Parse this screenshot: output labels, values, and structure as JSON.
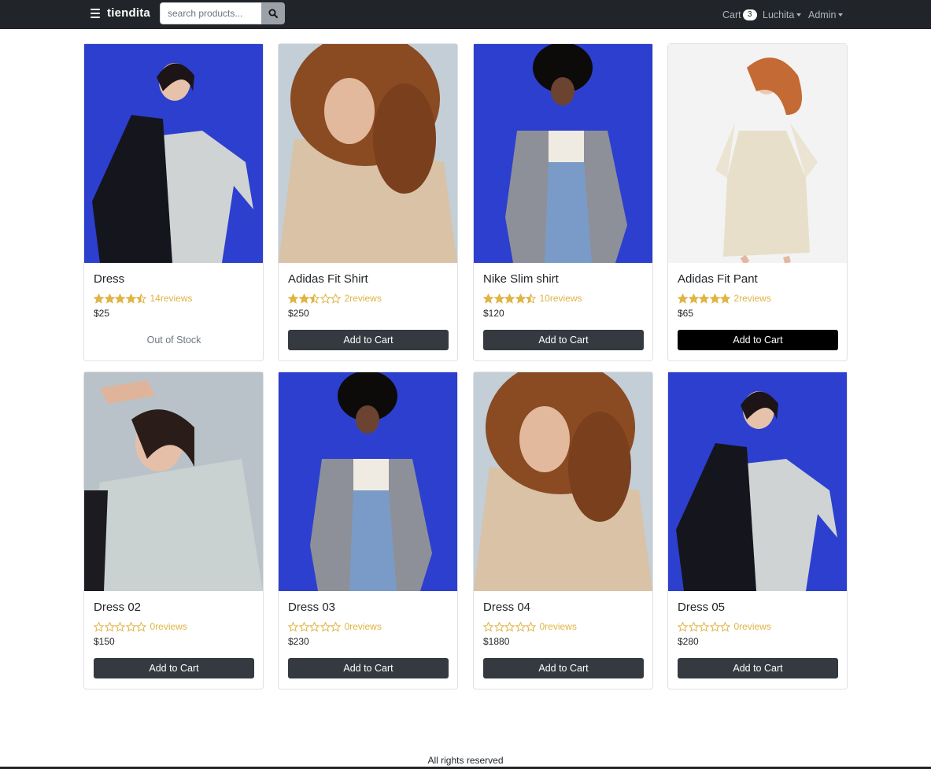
{
  "navbar": {
    "brand": "tiendita",
    "search": {
      "placeholder": "search products...",
      "value": ""
    },
    "cart": {
      "label": "Cart",
      "count": "3"
    },
    "user_menu": "Luchita",
    "admin_menu": "Admin"
  },
  "colors": {
    "navbar": "#212529",
    "button": "#343a40",
    "star": "#e0b445",
    "photo_blue": "#2d3fce",
    "photo_sky": "#c3ced6",
    "photo_white": "#f3f3f3"
  },
  "products": [
    {
      "name": "Dress",
      "rating": 4.5,
      "reviews": "14reviews",
      "price": "$25",
      "action": "Out of Stock",
      "in_stock": false,
      "photo": "coat-dress-blue"
    },
    {
      "name": "Adidas Fit Shirt",
      "rating": 2.5,
      "reviews": "2reviews",
      "price": "$250",
      "action": "Add to Cart",
      "in_stock": true,
      "photo": "curly-sweater-sky"
    },
    {
      "name": "Nike Slim shirt",
      "rating": 4.5,
      "reviews": "10reviews",
      "price": "$120",
      "action": "Add to Cart",
      "in_stock": true,
      "photo": "coat-jeans-blue"
    },
    {
      "name": "Adidas Fit Pant",
      "rating": 5,
      "reviews": "2reviews",
      "price": "$65",
      "action": "Add to Cart",
      "in_stock": true,
      "photo": "cream-dress-white"
    },
    {
      "name": "Dress 02",
      "rating": 0,
      "reviews": "0reviews",
      "price": "$150",
      "action": "Add to Cart",
      "in_stock": true,
      "photo": "dress-closeup-sky"
    },
    {
      "name": "Dress 03",
      "rating": 0,
      "reviews": "0reviews",
      "price": "$230",
      "action": "Add to Cart",
      "in_stock": true,
      "photo": "coat-jeans-blue"
    },
    {
      "name": "Dress 04",
      "rating": 0,
      "reviews": "0reviews",
      "price": "$1880",
      "action": "Add to Cart",
      "in_stock": true,
      "photo": "curly-sweater-sky"
    },
    {
      "name": "Dress 05",
      "rating": 0,
      "reviews": "0reviews",
      "price": "$280",
      "action": "Add to Cart",
      "in_stock": true,
      "photo": "coat-dress-blue"
    }
  ],
  "footer": {
    "text": "All rights reserved"
  }
}
